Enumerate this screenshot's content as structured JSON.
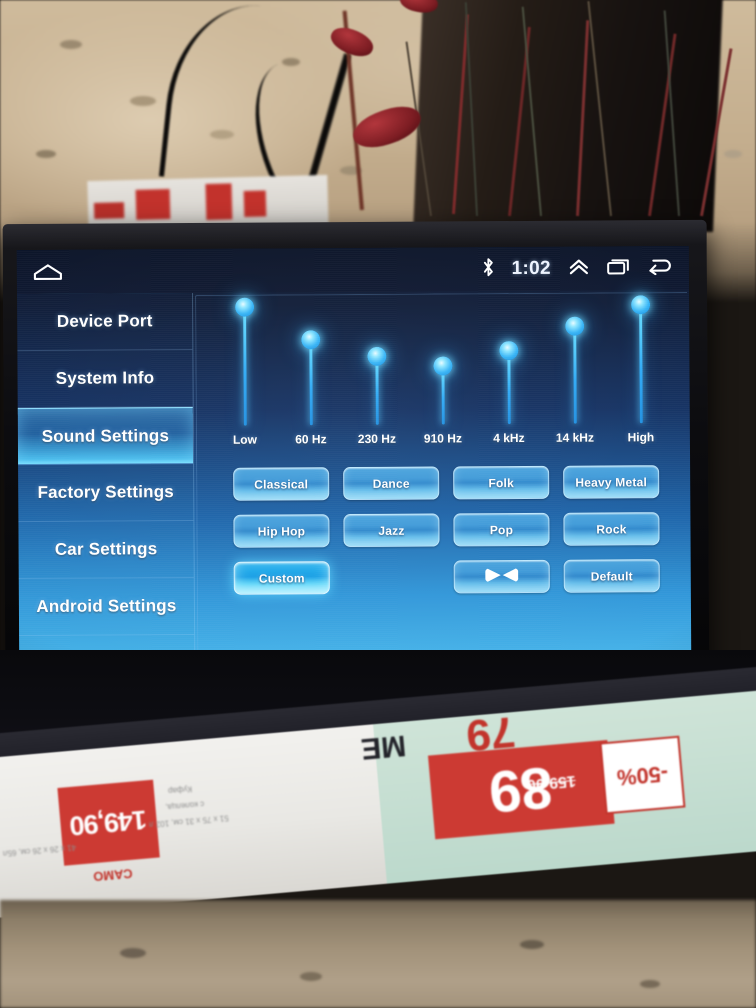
{
  "device": {
    "statusbar": {
      "home_icon": "home-icon",
      "bluetooth_icon": "bluetooth-icon",
      "time": "1:02",
      "chevron_up_icon": "double-chevron-up-icon",
      "recents_icon": "recents-icon",
      "back_icon": "back-arrow-icon"
    },
    "sidebar": {
      "items": [
        {
          "label": "Device Port",
          "active": false
        },
        {
          "label": "System Info",
          "active": false
        },
        {
          "label": "Sound Settings",
          "active": true
        },
        {
          "label": "Factory Settings",
          "active": false
        },
        {
          "label": "Car Settings",
          "active": false
        },
        {
          "label": "Android Settings",
          "active": false
        }
      ]
    },
    "equalizer": {
      "bands": [
        {
          "label": "Low",
          "value": 100
        },
        {
          "label": "60 Hz",
          "value": 72
        },
        {
          "label": "230 Hz",
          "value": 58
        },
        {
          "label": "910 Hz",
          "value": 49
        },
        {
          "label": "4 kHz",
          "value": 62
        },
        {
          "label": "14 kHz",
          "value": 82
        },
        {
          "label": "High",
          "value": 100
        }
      ]
    },
    "presets": [
      {
        "label": "Classical",
        "active": false,
        "icon": null
      },
      {
        "label": "Dance",
        "active": false,
        "icon": null
      },
      {
        "label": "Folk",
        "active": false,
        "icon": null
      },
      {
        "label": "Heavy Metal",
        "active": false,
        "icon": null
      },
      {
        "label": "Hip Hop",
        "active": false,
        "icon": null
      },
      {
        "label": "Jazz",
        "active": false,
        "icon": null
      },
      {
        "label": "Pop",
        "active": false,
        "icon": null
      },
      {
        "label": "Rock",
        "active": false,
        "icon": null
      },
      {
        "label": "Custom",
        "active": true,
        "icon": null
      },
      {
        "label": "",
        "active": false,
        "icon": null,
        "empty": true
      },
      {
        "label": "",
        "active": false,
        "icon": "bowtie-balance-icon"
      },
      {
        "label": "Default",
        "active": false,
        "icon": null
      }
    ]
  },
  "colors": {
    "accent_cyan": "#45b1e8",
    "slider_glow": "#6fe4ff",
    "panel_dark_navy": "#0d1830",
    "panel_bright_blue": "#45b1e8",
    "text_white": "#ffffff"
  },
  "background_scene": {
    "flyer_bottom": {
      "price_main": "149,90",
      "price_label": "САМО",
      "price_suffix": "*",
      "desc_line1": "Куфар",
      "desc_line2": "с колелца,",
      "desc_line3": "51 х 75 х 31 см, 102 л",
      "dims_note": "41 х 26 х 26 см, 65л",
      "magazine_word": "МЕ",
      "sale_big": "89",
      "sale_small": "79",
      "sale_old_price": "159.90",
      "discount_badge": "-50%"
    }
  }
}
